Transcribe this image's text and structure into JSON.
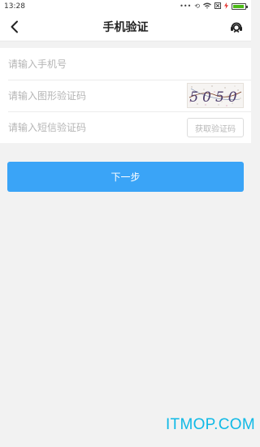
{
  "status_bar": {
    "time": "13:28",
    "icons": [
      "dots-icon",
      "sync-icon",
      "wifi-icon",
      "sim-icon",
      "charging-icon",
      "battery-icon"
    ],
    "battery_level": 0.95
  },
  "nav": {
    "title": "手机验证",
    "back_icon": "chevron-left-icon",
    "service_icon": "customer-service-icon"
  },
  "form": {
    "phone_placeholder": "请输入手机号",
    "captcha_placeholder": "请输入图形验证码",
    "captcha_text": "5050",
    "sms_placeholder": "请输入短信验证码",
    "sms_button_label": "获取验证码"
  },
  "next_button_label": "下一步",
  "watermark": "ITMOP.COM",
  "colors": {
    "primary": "#3aa4f7",
    "background": "#f2f2f2",
    "watermark": "#0fb9e6"
  }
}
